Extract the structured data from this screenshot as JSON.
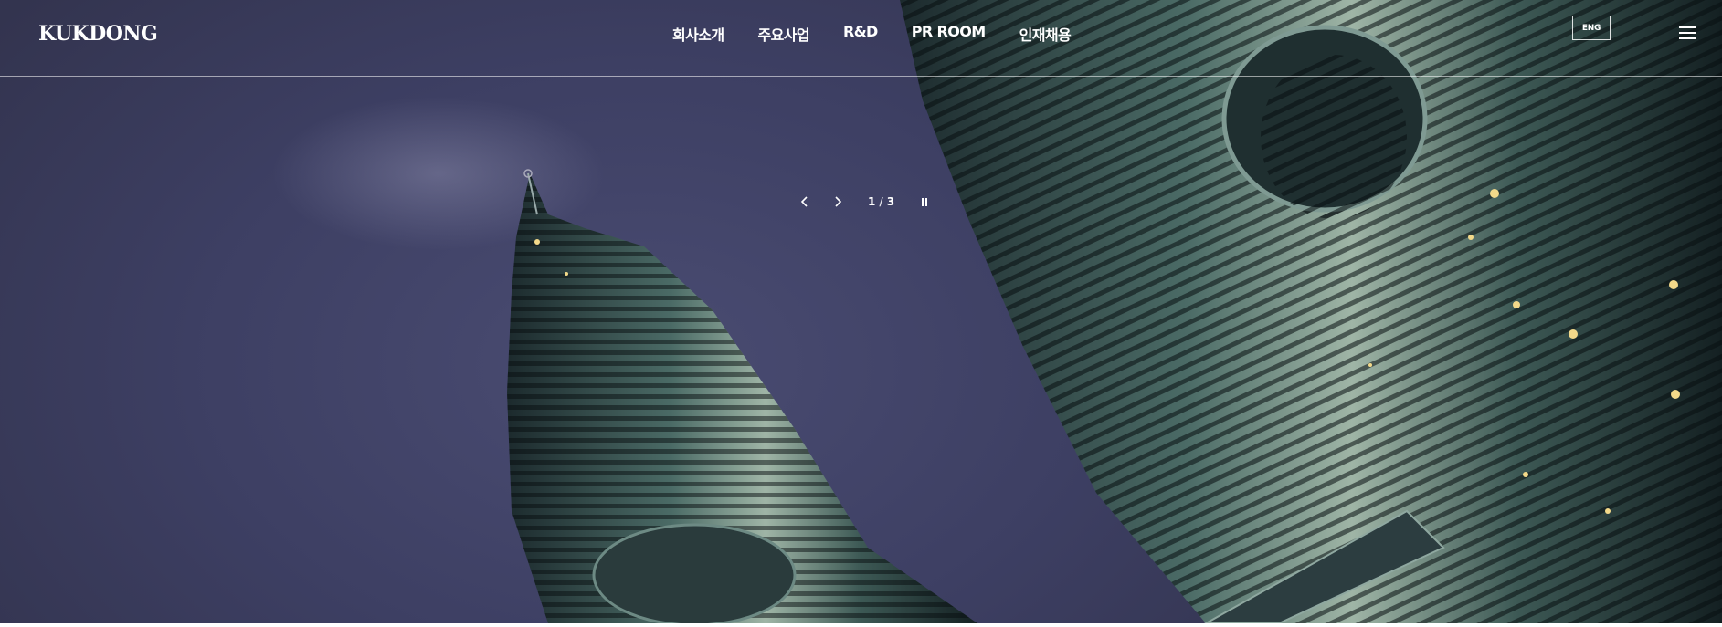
{
  "header": {
    "logo_text": "KUKDONG",
    "nav": [
      "회사소개",
      "주요사업",
      "R&D",
      "PR ROOM",
      "인재채용"
    ],
    "lang_label": "ENG",
    "menu_icon": "hamburger-icon"
  },
  "hero": {
    "image": "petronas-towers-night-photo",
    "slider": {
      "prev_icon": "chevron-left-icon",
      "next_icon": "chevron-right-icon",
      "current": "1",
      "separator": "/",
      "total": "3",
      "pause_icon": "pause-icon"
    }
  }
}
